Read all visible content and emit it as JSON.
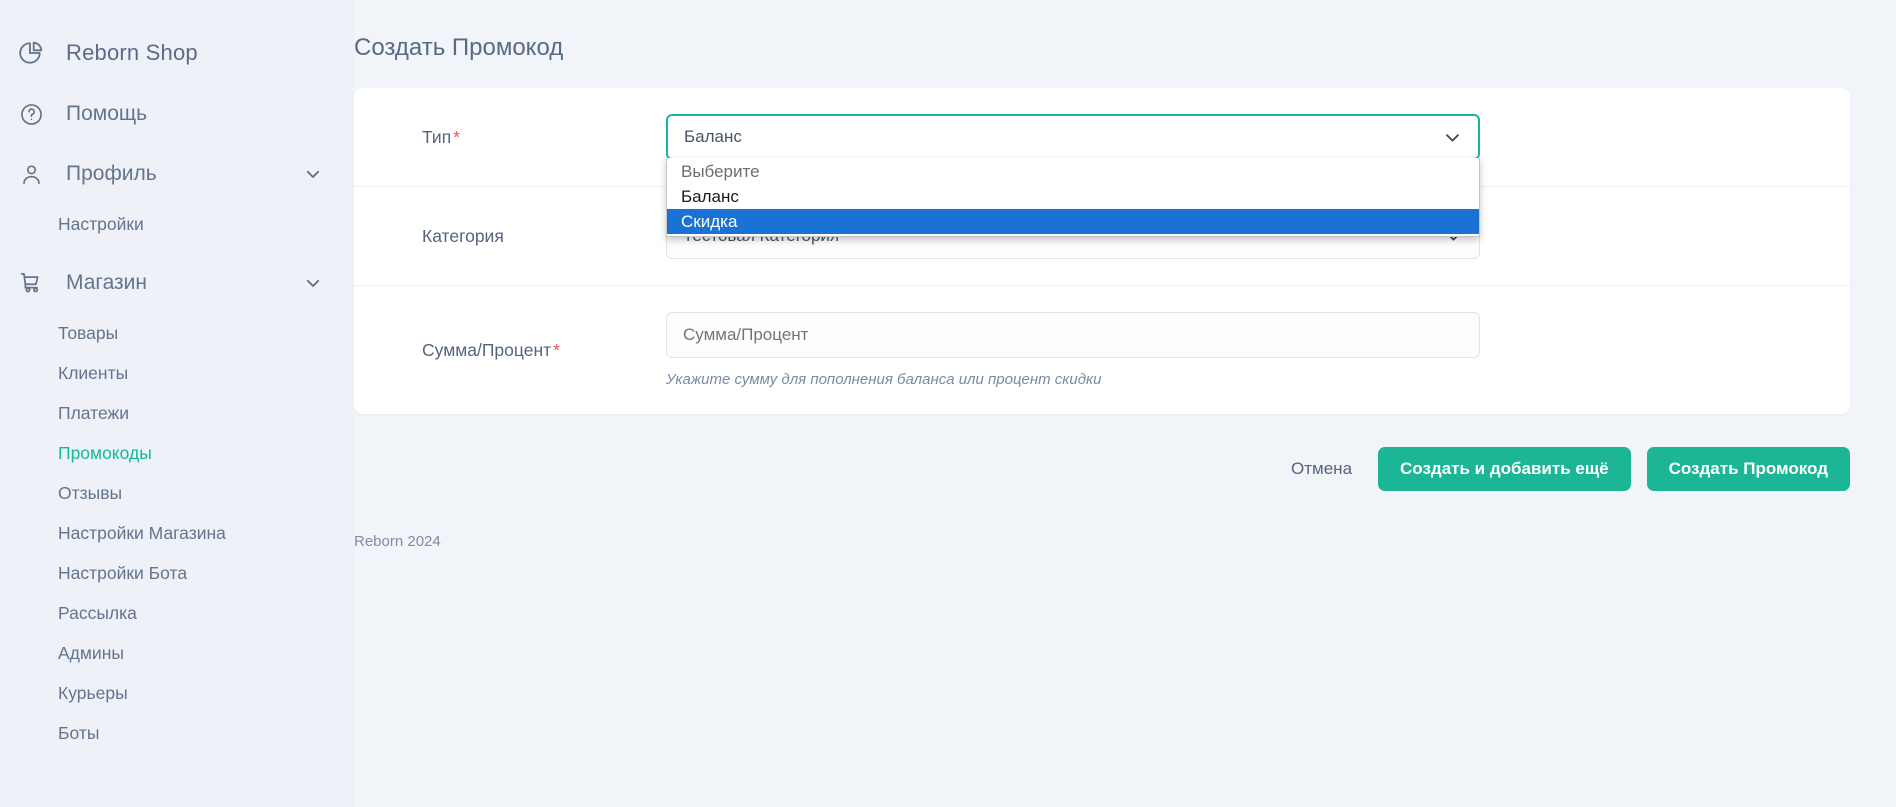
{
  "sidebar": {
    "brand": {
      "label": "Reborn Shop",
      "icon": "pie-chart-icon"
    },
    "help": {
      "label": "Помощь",
      "icon": "question-circle-icon"
    },
    "groups": [
      {
        "label": "Профиль",
        "icon": "user-icon",
        "expanded": true,
        "items": [
          {
            "label": "Настройки",
            "active": false
          }
        ]
      },
      {
        "label": "Магазин",
        "icon": "shopping-cart-icon",
        "expanded": true,
        "items": [
          {
            "label": "Товары",
            "active": false
          },
          {
            "label": "Клиенты",
            "active": false
          },
          {
            "label": "Платежи",
            "active": false
          },
          {
            "label": "Промокоды",
            "active": true
          },
          {
            "label": "Отзывы",
            "active": false
          },
          {
            "label": "Настройки Магазина",
            "active": false
          },
          {
            "label": "Настройки Бота",
            "active": false
          },
          {
            "label": "Рассылка",
            "active": false
          },
          {
            "label": "Админы",
            "active": false
          },
          {
            "label": "Курьеры",
            "active": false
          },
          {
            "label": "Боты",
            "active": false
          }
        ]
      }
    ]
  },
  "page": {
    "title": "Создать Промокод",
    "footer": "Reborn 2024"
  },
  "form": {
    "type_field": {
      "label": "Тип",
      "required_mark": "*",
      "value": "Баланс",
      "caret_icon": "chevron-down-icon",
      "options": [
        {
          "label": "Выберите",
          "state": "muted"
        },
        {
          "label": "Баланс",
          "state": "normal"
        },
        {
          "label": "Скидка",
          "state": "selected"
        }
      ]
    },
    "category_field": {
      "label": "Категория",
      "value": "Тестовая Категория",
      "caret_icon": "chevron-down-icon"
    },
    "amount_field": {
      "label": "Сумма/Процент",
      "required_mark": "*",
      "placeholder": "Сумма/Процент",
      "hint": "Укажите сумму для пополнения баланса или процент скидки"
    }
  },
  "actions": {
    "cancel": "Отмена",
    "create_and_add": "Создать и добавить ещё",
    "create": "Создать Промокод"
  },
  "colors": {
    "accent": "#1cb696",
    "active_link": "#16b89a",
    "required": "#ef5350",
    "dropdown_selected": "#1a73d4"
  }
}
